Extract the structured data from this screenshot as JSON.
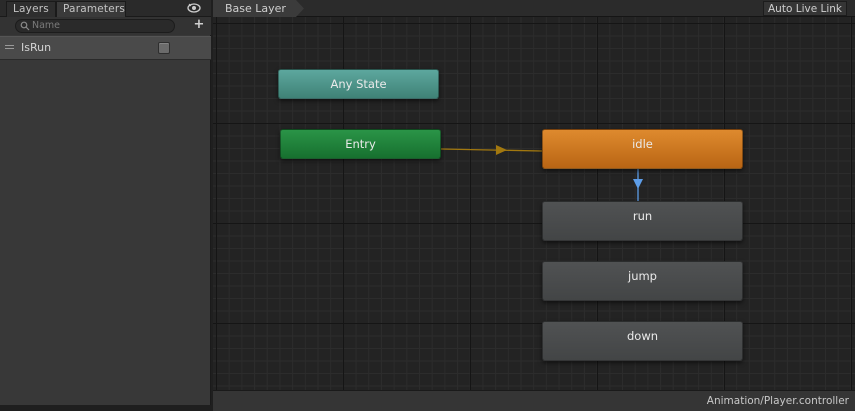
{
  "left_panel": {
    "tabs": [
      {
        "label": "Layers"
      },
      {
        "label": "Parameters"
      }
    ],
    "visibility_icon": "eye-icon",
    "search": {
      "placeholder": "Name",
      "value": ""
    },
    "add_icon": "plus-icon",
    "add_symbol": "+",
    "parameters": [
      {
        "name": "IsRun",
        "type": "bool",
        "value": false
      }
    ]
  },
  "graph": {
    "breadcrumb": "Base Layer",
    "live_link_label": "Auto Live Link",
    "states": [
      {
        "name": "Any State",
        "kind": "any",
        "color": "#4f968b"
      },
      {
        "name": "Entry",
        "kind": "entry",
        "color": "#1f8a3d"
      },
      {
        "name": "idle",
        "kind": "default",
        "color": "#cf7a22"
      },
      {
        "name": "run",
        "kind": "state",
        "color": "#4a4c4d"
      },
      {
        "name": "jump",
        "kind": "state",
        "color": "#4a4c4d"
      },
      {
        "name": "down",
        "kind": "state",
        "color": "#4a4c4d"
      }
    ],
    "transitions": [
      {
        "from": "Entry",
        "to": "idle",
        "color": "#a2780f"
      },
      {
        "from": "idle",
        "to": "run",
        "color": "#5d9de8"
      }
    ],
    "status_path": "Animation/Player.controller"
  }
}
